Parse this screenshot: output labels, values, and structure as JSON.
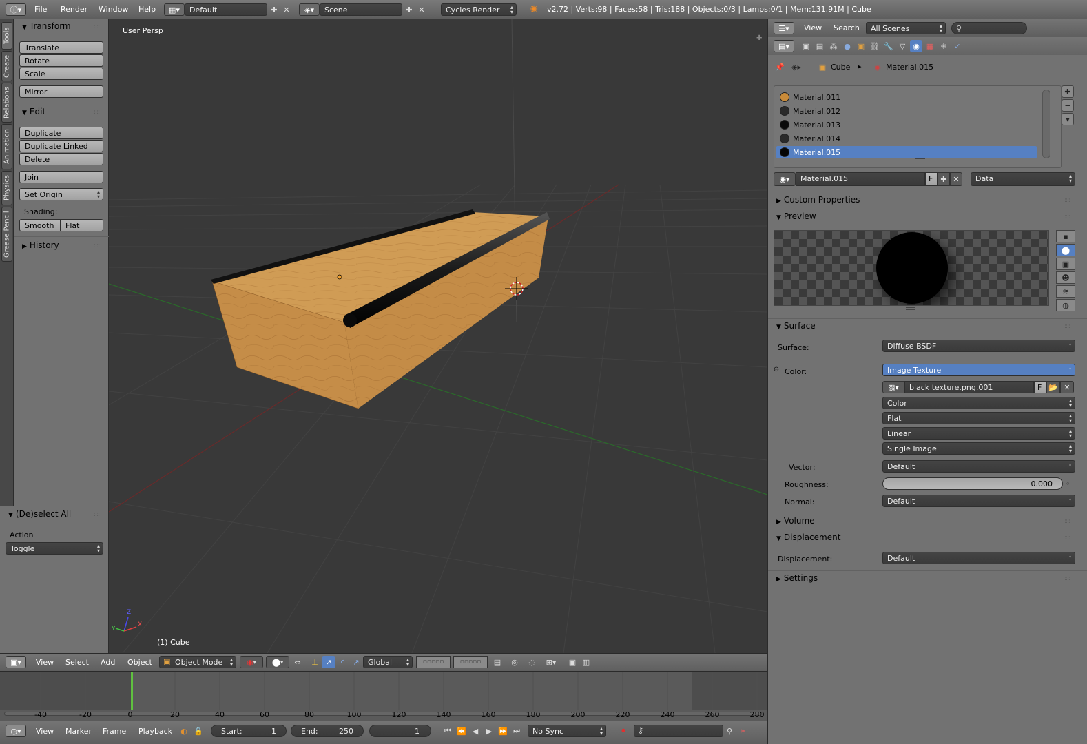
{
  "topbar": {
    "menus": [
      "File",
      "Render",
      "Window",
      "Help"
    ],
    "layout": "Default",
    "scene": "Scene",
    "engine": "Cycles Render",
    "stats": "v2.72 | Verts:98 | Faces:58 | Tris:188 | Objects:0/3 | Lamps:0/1 | Mem:131.91M | Cube"
  },
  "tabs": [
    "Tools",
    "Create",
    "Relations",
    "Animation",
    "Physics",
    "Grease Pencil"
  ],
  "shelf": {
    "transform_title": "Transform",
    "translate": "Translate",
    "rotate": "Rotate",
    "scale": "Scale",
    "mirror": "Mirror",
    "edit_title": "Edit",
    "duplicate": "Duplicate",
    "duplicate_linked": "Duplicate Linked",
    "delete": "Delete",
    "join": "Join",
    "set_origin": "Set Origin",
    "shading_label": "Shading:",
    "smooth": "Smooth",
    "flat": "Flat",
    "history_title": "History"
  },
  "operator": {
    "title": "(De)select All",
    "action_label": "Action",
    "action_value": "Toggle"
  },
  "viewport": {
    "view_name": "User Persp",
    "object_label": "(1) Cube",
    "axis_x": "X",
    "axis_y": "Y",
    "axis_z": "Z"
  },
  "view_header": {
    "menus": [
      "View",
      "Select",
      "Add",
      "Object"
    ],
    "mode": "Object Mode",
    "orientation": "Global"
  },
  "timeline": {
    "ticks": [
      "-40",
      "-20",
      "0",
      "20",
      "40",
      "60",
      "80",
      "100",
      "120",
      "140",
      "160",
      "180",
      "200",
      "220",
      "240",
      "260",
      "280"
    ],
    "current_frame_marker": 0
  },
  "timeline_header": {
    "menus": [
      "View",
      "Marker",
      "Frame",
      "Playback"
    ],
    "start_label": "Start:",
    "start_value": "1",
    "end_label": "End:",
    "end_value": "250",
    "current": "1",
    "sync": "No Sync"
  },
  "props": {
    "header": {
      "view": "View",
      "search": "Search",
      "scenes": "All Scenes"
    },
    "breadcrumb": {
      "object": "Cube",
      "material": "Material.015"
    },
    "materials": [
      {
        "name": "Material.011",
        "color": "#c98b3a",
        "selected": false
      },
      {
        "name": "Material.012",
        "color": "#2a2a2a",
        "selected": false
      },
      {
        "name": "Material.013",
        "color": "#0a0a0a",
        "selected": false
      },
      {
        "name": "Material.014",
        "color": "#2a2a2a",
        "selected": false
      },
      {
        "name": "Material.015",
        "color": "#050505",
        "selected": true
      }
    ],
    "datablock": {
      "name": "Material.015",
      "fake": "F",
      "link": "Data"
    },
    "panels": {
      "custom_properties": "Custom Properties",
      "preview": "Preview",
      "surface": "Surface",
      "volume": "Volume",
      "displacement": "Displacement",
      "settings": "Settings"
    },
    "surface": {
      "surface_label": "Surface:",
      "surface_value": "Diffuse BSDF",
      "color_label": "Color:",
      "color_value": "Image Texture",
      "image_name": "black texture.png.001",
      "image_fake": "F",
      "color_space": "Color",
      "projection": "Flat",
      "interpolation": "Linear",
      "source": "Single Image",
      "vector_label": "Vector:",
      "vector_value": "Default",
      "roughness_label": "Roughness:",
      "roughness_value": "0.000",
      "normal_label": "Normal:",
      "normal_value": "Default"
    },
    "displacement": {
      "label": "Displacement:",
      "value": "Default"
    }
  },
  "colors": {
    "selection": "#5680c2",
    "header": "#727272",
    "viewport_bg": "#393939",
    "wood": "#c8974f",
    "frame_marker": "#60c040"
  }
}
